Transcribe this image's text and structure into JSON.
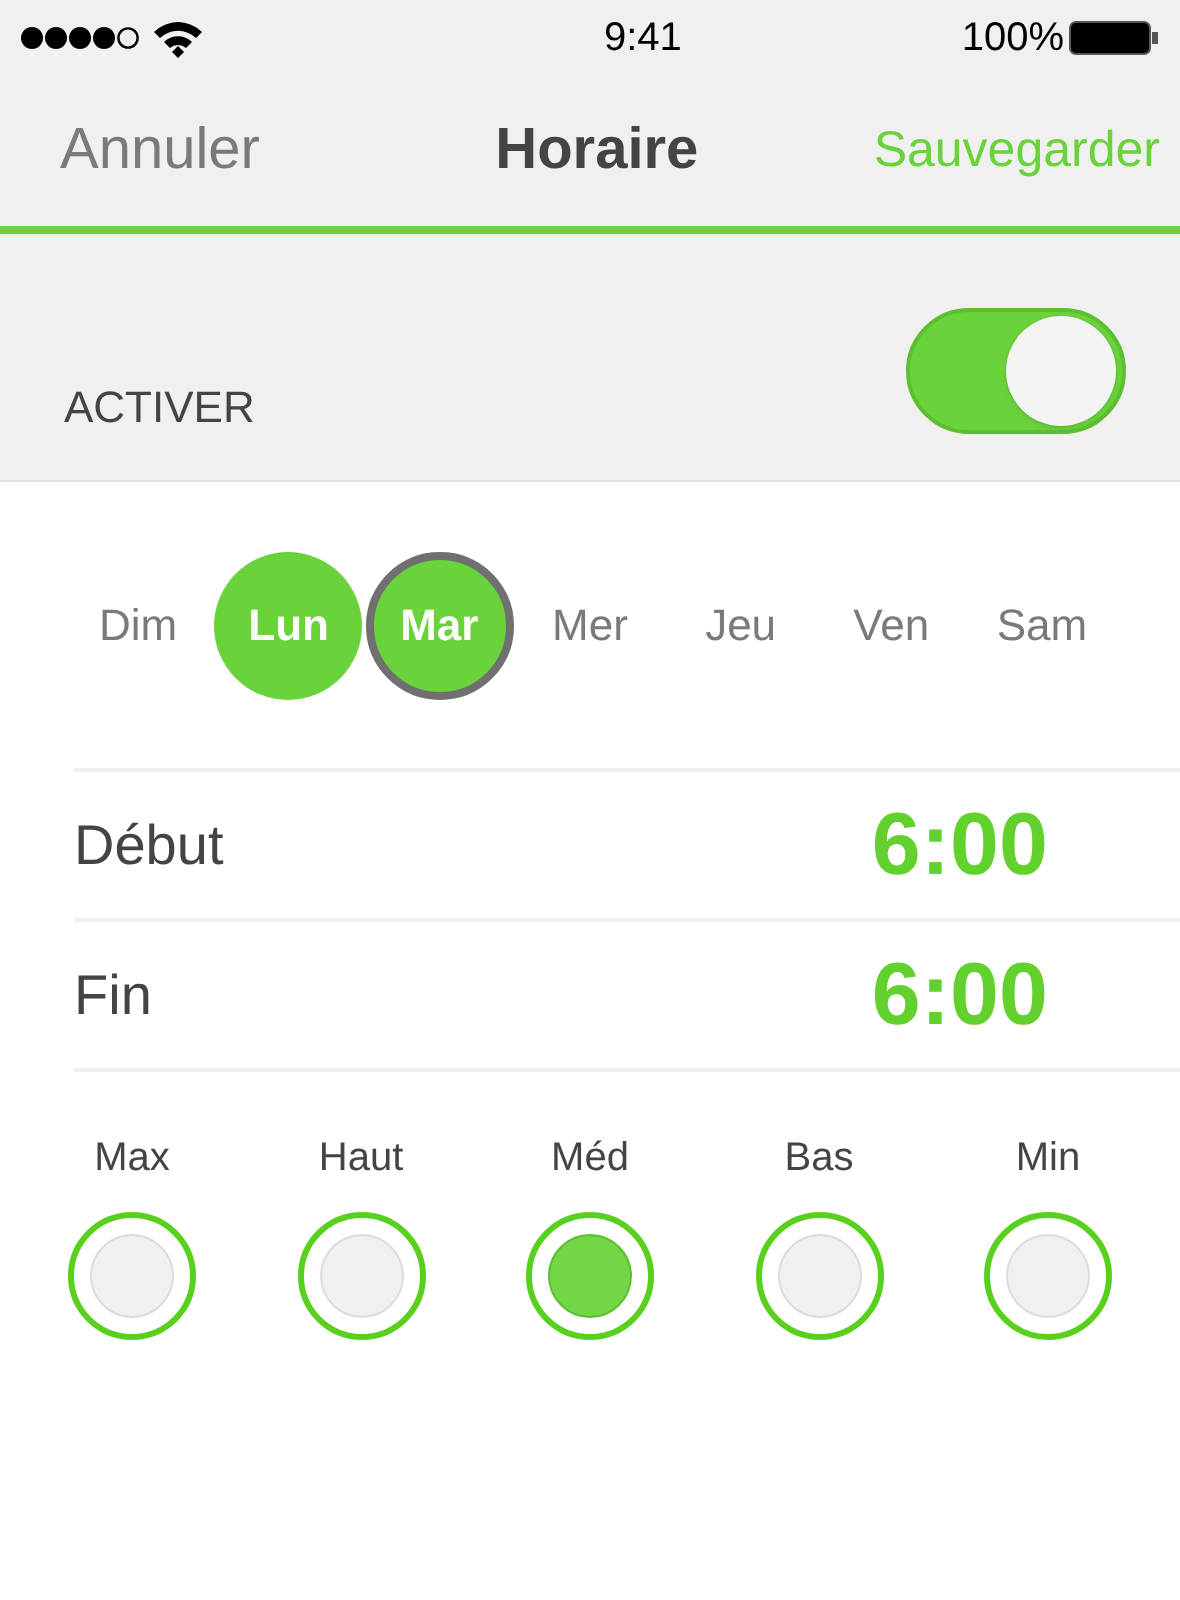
{
  "status_bar": {
    "time": "9:41",
    "battery": "100%"
  },
  "nav": {
    "cancel": "Annuler",
    "title": "Horaire",
    "save": "Sauvegarder"
  },
  "enable": {
    "label": "ACTIVER",
    "on": true
  },
  "days": [
    {
      "label": "Dim",
      "selected": false,
      "focused": false
    },
    {
      "label": "Lun",
      "selected": true,
      "focused": false
    },
    {
      "label": "Mar",
      "selected": true,
      "focused": true
    },
    {
      "label": "Mer",
      "selected": false,
      "focused": false
    },
    {
      "label": "Jeu",
      "selected": false,
      "focused": false
    },
    {
      "label": "Ven",
      "selected": false,
      "focused": false
    },
    {
      "label": "Sam",
      "selected": false,
      "focused": false
    }
  ],
  "times": [
    {
      "label": "Début",
      "value": "6:00"
    },
    {
      "label": "Fin",
      "value": "6:00"
    }
  ],
  "levels": [
    {
      "label": "Max",
      "selected": false
    },
    {
      "label": "Haut",
      "selected": false
    },
    {
      "label": "Méd",
      "selected": true
    },
    {
      "label": "Bas",
      "selected": false
    },
    {
      "label": "Min",
      "selected": false
    }
  ]
}
